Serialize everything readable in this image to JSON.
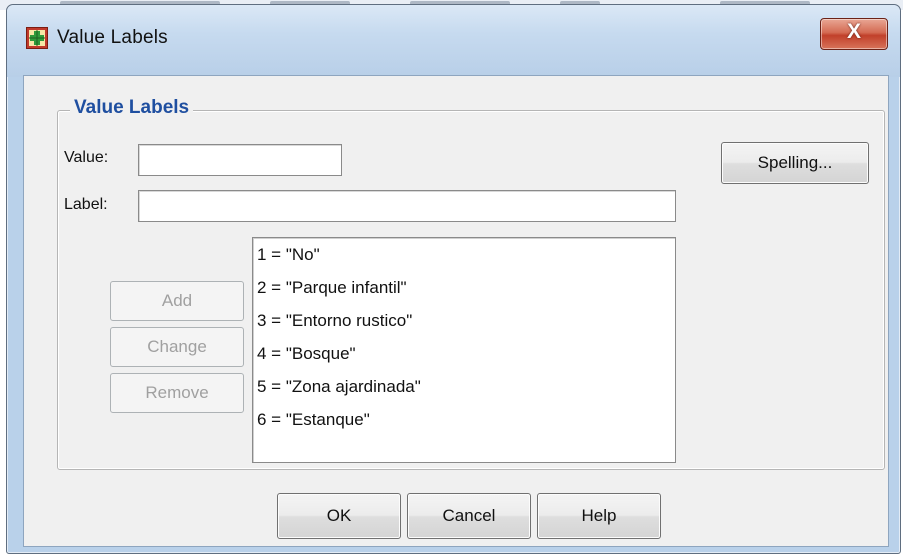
{
  "window": {
    "title": "Value Labels",
    "close_label": "X"
  },
  "group": {
    "title": "Value Labels"
  },
  "fields": {
    "value_label": "Value:",
    "value_input": "",
    "label_label": "Label:",
    "label_input": ""
  },
  "buttons": {
    "spelling": "Spelling...",
    "add": "Add",
    "change": "Change",
    "remove": "Remove",
    "ok": "OK",
    "cancel": "Cancel",
    "help": "Help"
  },
  "value_labels": [
    "1 = \"No\"",
    "2 = \"Parque infantil\"",
    "3 = \"Entorno rustico\"",
    "4 = \"Bosque\"",
    "5 = \"Zona ajardinada\"",
    "6 = \"Estanque\""
  ],
  "colors": {
    "group_title": "#1f4fa0",
    "close_button": "#c1402a"
  },
  "icons": {
    "app": "spss-variable-grid-icon"
  }
}
